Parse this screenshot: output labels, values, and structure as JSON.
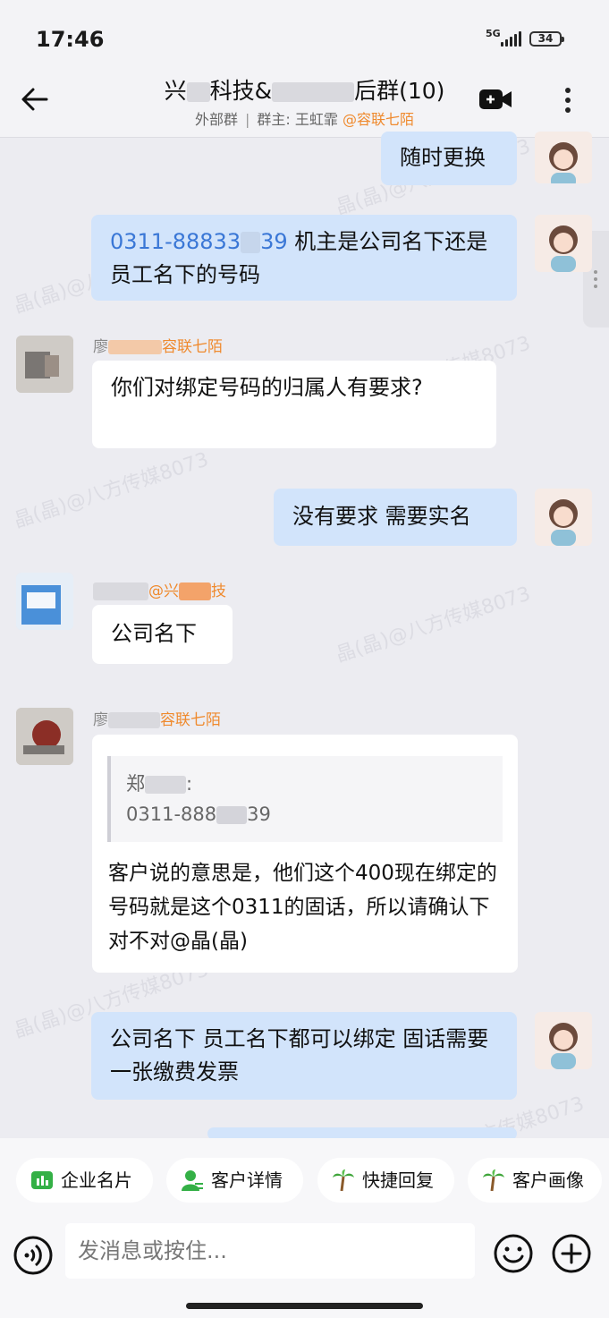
{
  "status_bar": {
    "time": "17:46",
    "network": "5G",
    "battery": "34"
  },
  "header": {
    "title_left": "兴",
    "title_mid": "科技&",
    "title_right": "后群(10)",
    "subtitle_type": "外部群",
    "subtitle_owner": "群主: 王虹霏",
    "subtitle_org": "@容联七陌"
  },
  "messages": [
    {
      "id": "m1",
      "from": "me",
      "text": "随时更换"
    },
    {
      "id": "m2",
      "from": "me",
      "phone_part1": "0311-88833",
      "phone_part2": "39",
      "text": " 机主是公司名下还是员工名下的号码"
    },
    {
      "id": "m3",
      "from": "other",
      "sender_name": "廖",
      "sender_org": "容联七陌",
      "text": "你们对绑定号码的归属人有要求?"
    },
    {
      "id": "m4",
      "from": "me",
      "text": "没有要求 需要实名"
    },
    {
      "id": "m5",
      "from": "other",
      "sender_org_prefix": "@兴",
      "sender_org_suffix": "技",
      "text": "公司名下"
    },
    {
      "id": "m6",
      "from": "other",
      "sender_name": "廖",
      "sender_org": "容联七陌",
      "quote_name": "郑",
      "quote_text_1": "0311-888",
      "quote_text_2": "39",
      "text": "客户说的意思是，他们这个400现在绑定的号码就是这个0311的固话，所以请确认下对不对@晶(晶)"
    },
    {
      "id": "m7",
      "from": "me",
      "text": "公司名下  员工名下都可以绑定  固话需要一张缴费发票"
    }
  ],
  "watermark_text": "晶(晶)@八方传媒8073",
  "quick_actions": [
    {
      "label": "企业名片",
      "icon": "business-card-icon",
      "color": "#34b046"
    },
    {
      "label": "客户详情",
      "icon": "customer-detail-icon",
      "color": "#34b046"
    },
    {
      "label": "快捷回复",
      "icon": "palm-tree-icon",
      "color": "#e6731c"
    },
    {
      "label": "客户画像",
      "icon": "palm-tree-icon",
      "color": "#e6731c"
    }
  ],
  "composer": {
    "placeholder": "发消息或按住..."
  }
}
